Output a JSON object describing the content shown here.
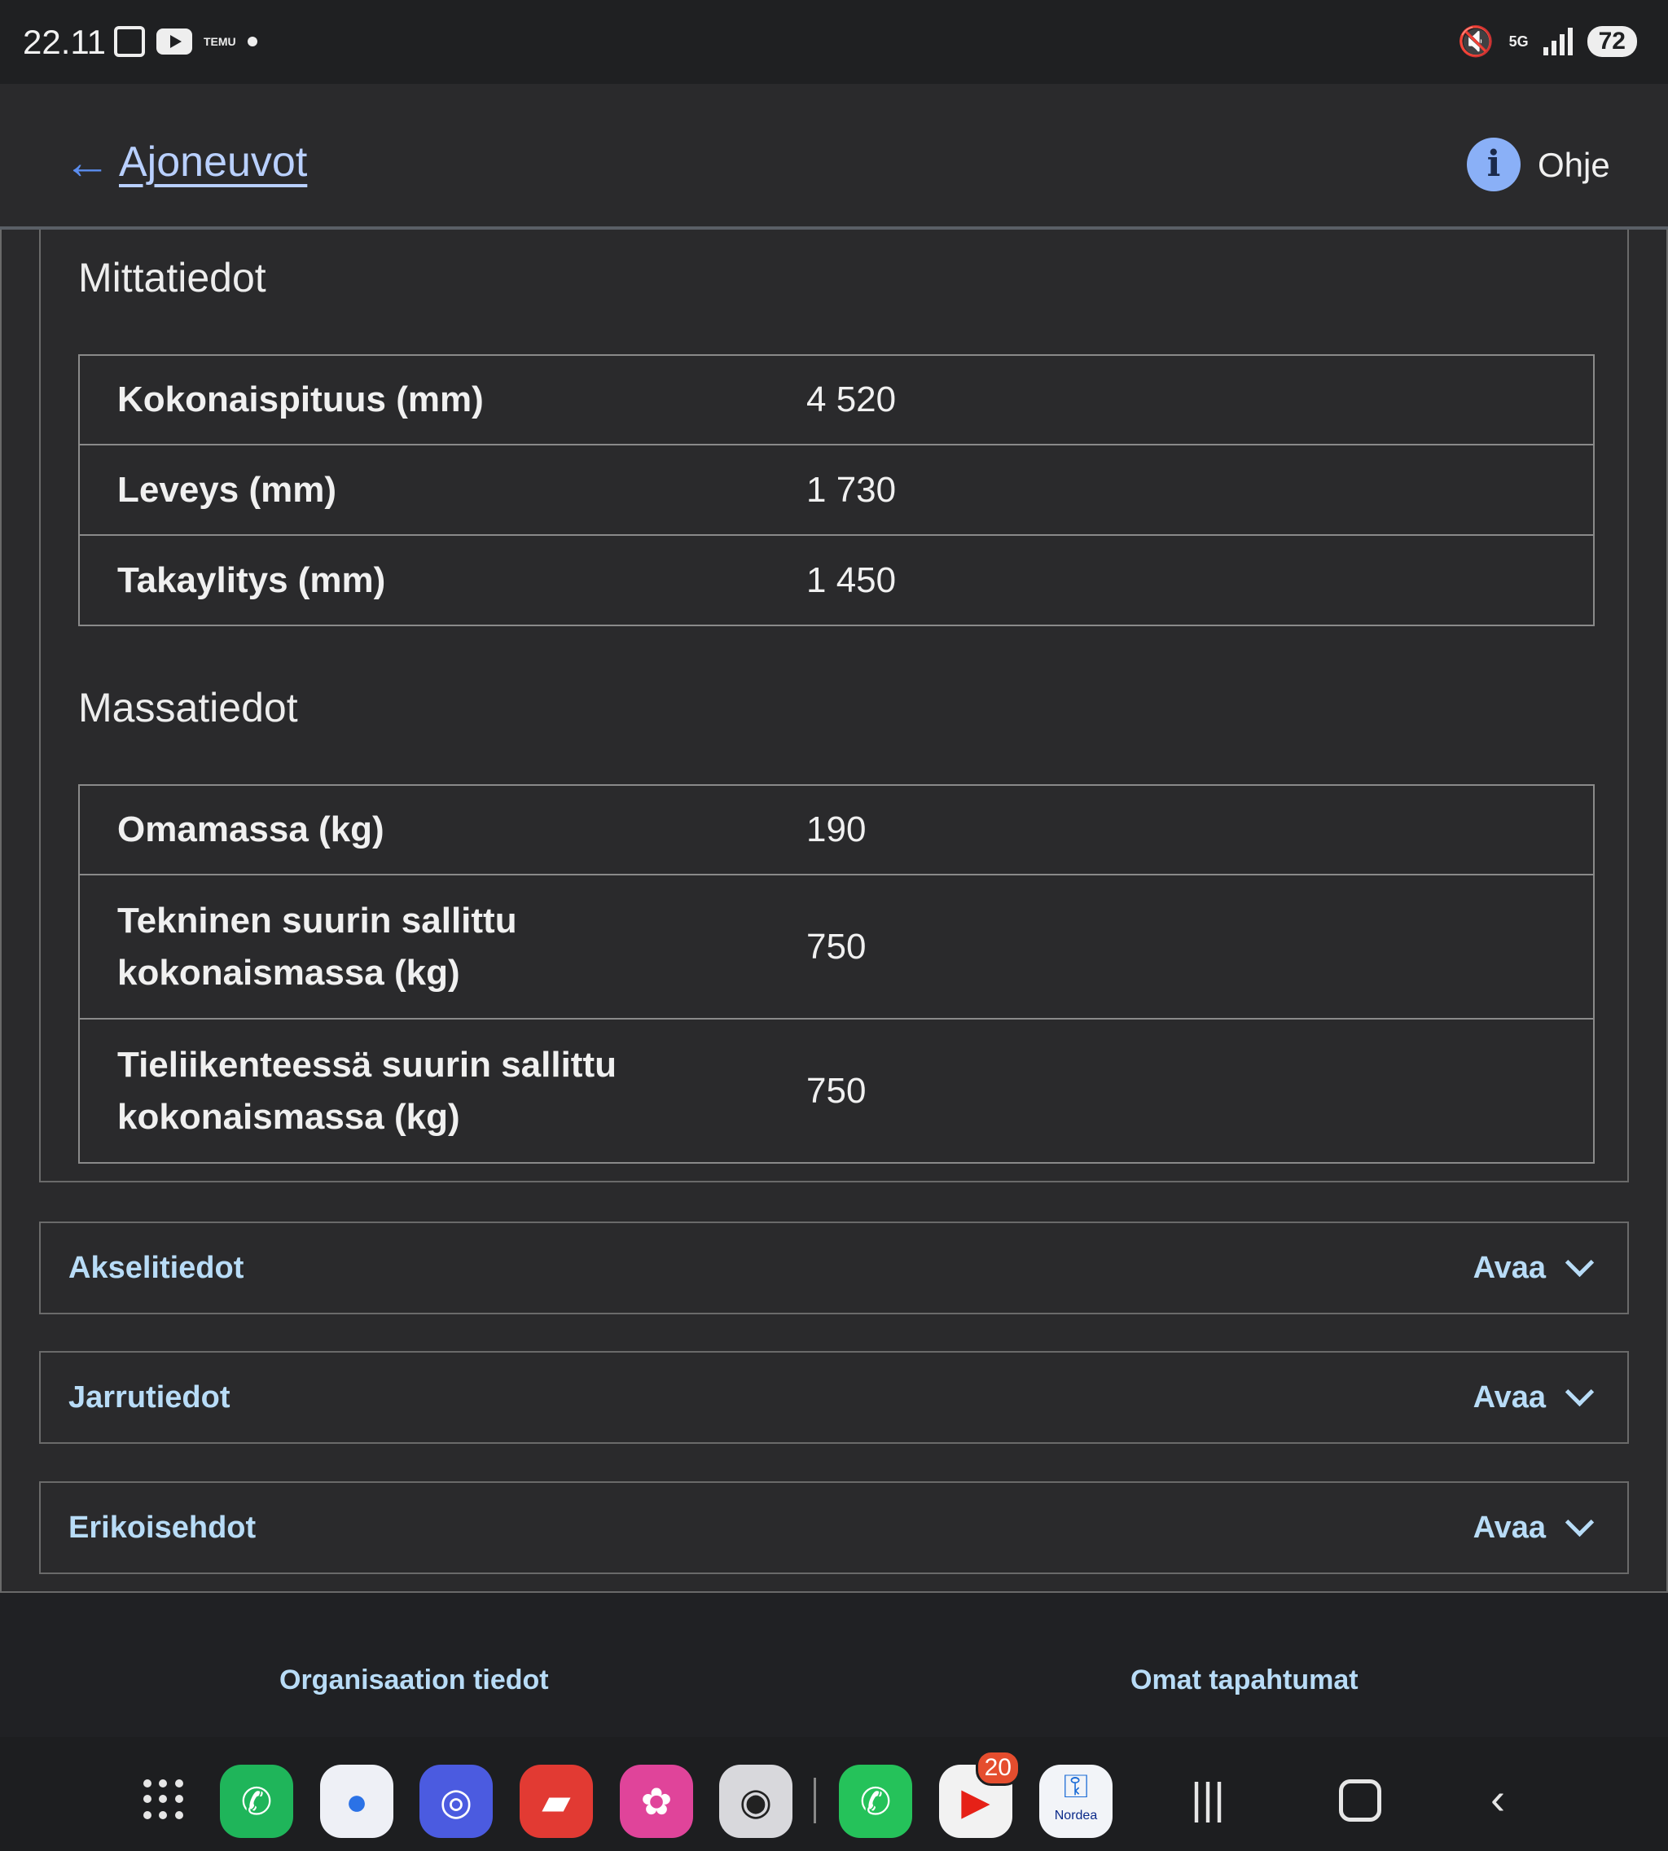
{
  "status_bar": {
    "time": "22.11",
    "temu_label": "TEMU",
    "network": "5G",
    "battery": "72"
  },
  "header": {
    "back_label": "Ajoneuvot",
    "help_label": "Ohje",
    "help_icon_glyph": "i"
  },
  "measurements": {
    "title": "Mittatiedot",
    "rows": [
      {
        "label": "Kokonaispituus (mm)",
        "value": "4 520"
      },
      {
        "label": "Leveys (mm)",
        "value": "1 730"
      },
      {
        "label": "Takaylitys (mm)",
        "value": "1 450"
      }
    ]
  },
  "mass": {
    "title": "Massatiedot",
    "rows": [
      {
        "label": "Omamassa (kg)",
        "value": "190"
      },
      {
        "label": "Tekninen suurin sallittu kokonaismassa (kg)",
        "value": "750"
      },
      {
        "label": "Tieliikenteessä suurin sallittu kokonaismassa (kg)",
        "value": "750"
      }
    ]
  },
  "accordions": [
    {
      "label": "Akselitiedot",
      "action": "Avaa"
    },
    {
      "label": "Jarrutiedot",
      "action": "Avaa"
    },
    {
      "label": "Erikoisehdot",
      "action": "Avaa"
    }
  ],
  "footer": {
    "left_link": "Organisaation tiedot",
    "right_link": "Omat tapahtumat"
  },
  "dock": {
    "youtube_badge": "20",
    "nordea_label": "Nordea"
  },
  "colors": {
    "accent_link": "#b8dcf7",
    "back_link": "#b9d0ff",
    "background": "#2a2a2c",
    "help_icon": "#8ab0f7"
  }
}
